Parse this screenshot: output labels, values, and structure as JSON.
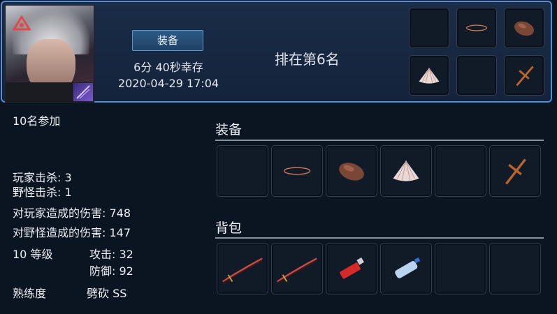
{
  "header": {
    "equip_label": "装备",
    "survive_time": "6分 40秒幸存",
    "date": "2020-04-29 17:04",
    "rank_text": "排在第6名",
    "equipment_slots": [
      "empty",
      "ring",
      "leather-pouch-icon",
      "seashell-icon",
      "empty",
      "wooden-cross-icon"
    ]
  },
  "stats": {
    "participants": "10名参加",
    "player_kills": "玩家击杀: 3",
    "monster_kills": "野怪击杀: 1",
    "damage_to_players": "对玩家造成的伤害: 748",
    "damage_to_monsters": "对野怪造成的伤害: 147",
    "level": "10 等级",
    "attack": "攻击: 32",
    "defense": "防御: 92",
    "proficiency_label": "熟练度",
    "proficiency_value": "劈砍 SS"
  },
  "equipment_section": {
    "title": "装备",
    "slots": [
      "empty",
      "ring-icon",
      "leather-pouch-icon",
      "seashell-icon",
      "empty",
      "wooden-cross-icon"
    ]
  },
  "backpack_section": {
    "title": "背包",
    "slots": [
      "katana-icon",
      "katana-icon",
      "lighter-icon",
      "water-bottle-icon",
      "empty",
      "empty"
    ]
  },
  "colors": {
    "accent_border": "#4f8fd6",
    "panel_bg": "#0b1421",
    "header_bg": "#1a2c47"
  }
}
